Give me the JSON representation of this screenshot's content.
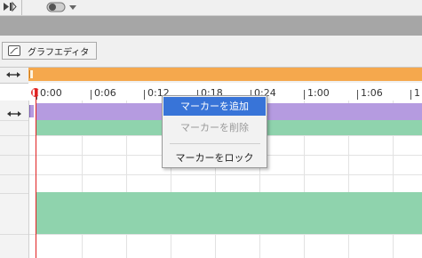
{
  "toolbar": {
    "icons": [
      "play-step-icon",
      "toggle-switch-icon",
      "dropdown-arrow-icon"
    ]
  },
  "graph_editor": {
    "label": "グラフエディタ",
    "icon": "graph-editor-icon"
  },
  "ruler": {
    "ticks": [
      "0:00",
      "0:06",
      "0:12",
      "0:18",
      "0:24",
      "1:00",
      "1:06",
      "1"
    ]
  },
  "context_menu": {
    "items": [
      {
        "label": "マーカーを追加",
        "state": "highlighted"
      },
      {
        "label": "マーカーを削除",
        "state": "disabled"
      },
      {
        "label": "マーカーをロック",
        "state": "normal"
      }
    ]
  },
  "colors": {
    "marker_track": "#f5a84d",
    "purple_track": "#b59be0",
    "green_track": "#8fd3ad",
    "playhead": "#e02020",
    "menu_highlight": "#3874d8"
  }
}
